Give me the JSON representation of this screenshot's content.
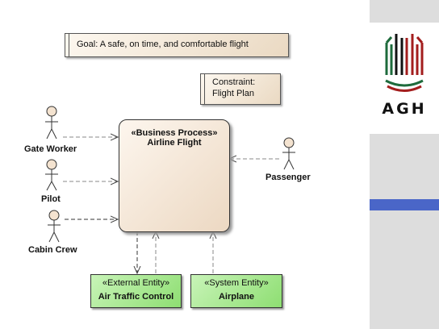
{
  "diagram": {
    "goal_note": "Goal: A safe, on time, and comfortable flight",
    "constraint_note": {
      "line1": "Constraint:",
      "line2": "Flight Plan"
    },
    "process": {
      "stereotype": "«Business Process»",
      "name": "Airline Flight"
    },
    "actors": [
      {
        "name": "Gate Worker"
      },
      {
        "name": "Pilot"
      },
      {
        "name": "Cabin Crew"
      },
      {
        "name": "Passenger"
      }
    ],
    "entities": {
      "atc": {
        "stereotype": "«External Entity»",
        "name": "Air Traffic Control"
      },
      "airplane": {
        "stereotype": "«System Entity»",
        "name": "Airplane"
      }
    }
  },
  "logo": {
    "text": "AGH",
    "colors": {
      "green": "#1e6b3c",
      "red": "#a31d1d",
      "black": "#111111"
    }
  },
  "colors": {
    "sidebar": "#dddddd",
    "accent": "#4a66c8",
    "entity_fill": "#a8e892",
    "process_fill": "#f5e6d6"
  }
}
